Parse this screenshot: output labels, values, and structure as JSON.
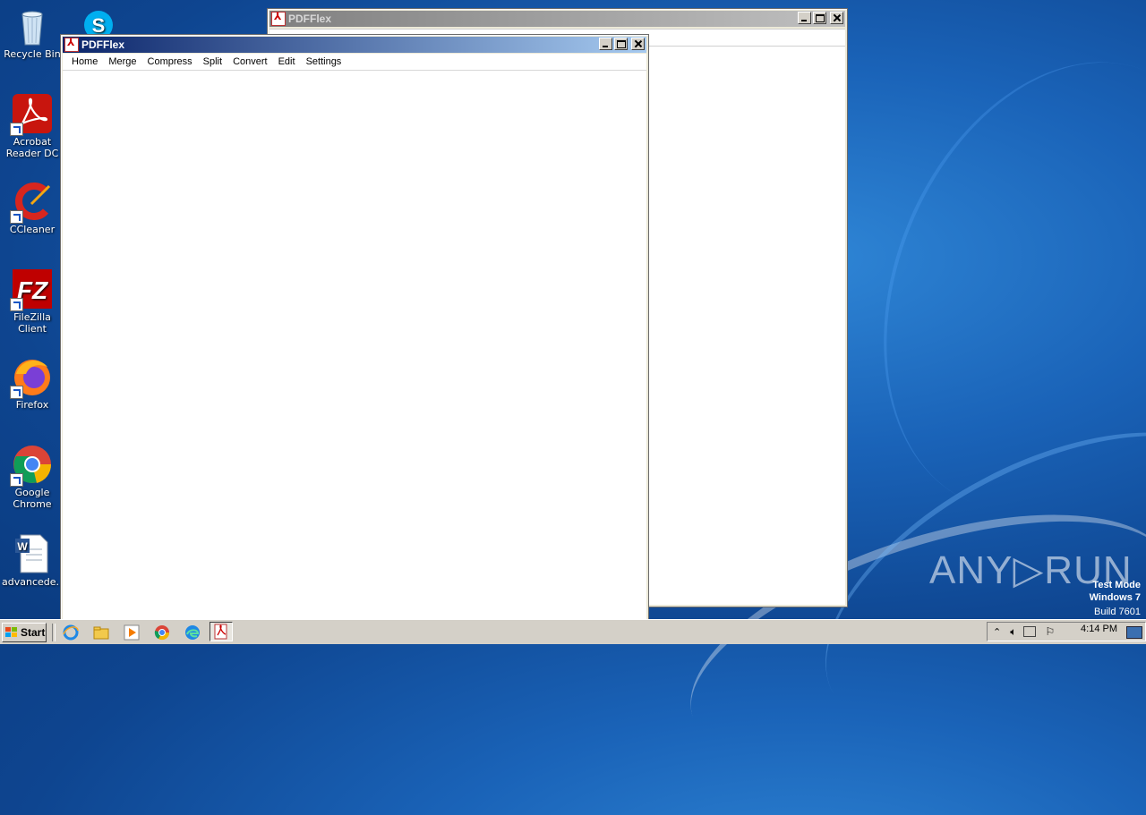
{
  "desktop": {
    "icons": [
      {
        "label": "Recycle Bin",
        "icon": "recycle-bin-icon"
      },
      {
        "label": "Acrobat Reader DC",
        "icon": "acrobat-reader-icon"
      },
      {
        "label": "CCleaner",
        "icon": "ccleaner-icon"
      },
      {
        "label": "FileZilla Client",
        "icon": "filezilla-icon"
      },
      {
        "label": "Firefox",
        "icon": "firefox-icon"
      },
      {
        "label": "Google Chrome",
        "icon": "chrome-icon"
      },
      {
        "label": "advancede...",
        "icon": "word-document-icon"
      }
    ]
  },
  "back_window": {
    "title": "PDFFlex"
  },
  "front_window": {
    "title": "PDFFlex",
    "menu": [
      "Home",
      "Merge",
      "Compress",
      "Split",
      "Convert",
      "Edit",
      "Settings"
    ]
  },
  "taskbar": {
    "start_label": "Start",
    "clock": "4:14 PM"
  },
  "watermark": {
    "brand": "ANY▷RUN",
    "line1": "Test Mode",
    "line2": "Windows 7",
    "line3": "Build 7601"
  },
  "colors": {
    "titlebar_active_start": "#0a246a",
    "titlebar_active_end": "#a6caf0",
    "titlebar_inactive_start": "#808080",
    "titlebar_inactive_end": "#c0c0c0",
    "desktop": "#1a63b8"
  }
}
